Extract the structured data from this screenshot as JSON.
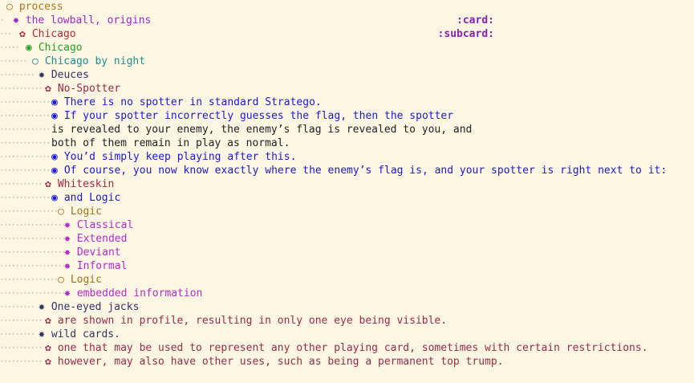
{
  "colors": {
    "background": "#fdf6e3",
    "orange": "#b5741d",
    "purple": "#9b2ac4",
    "red": "#b02a3a",
    "green": "#2a9d2a",
    "teal": "#1e8f8f",
    "navy": "#333366",
    "blue": "#1a1ad6",
    "maroon": "#9a2a4a",
    "magenta": "#b52ac8"
  },
  "lines": [
    {
      "indent": 0,
      "bullet": "○",
      "text": "process",
      "color": "orange"
    },
    {
      "indent": 1,
      "bullet": "✸",
      "text": "the lowball, origins",
      "color": "purple",
      "tag": ":card:"
    },
    {
      "indent": 2,
      "bullet": "✿",
      "text": "Chicago",
      "color": "red",
      "tag": ":subcard:"
    },
    {
      "indent": 3,
      "bullet": "◉",
      "text": "Chicago",
      "color": "green"
    },
    {
      "indent": 4,
      "bullet": "○",
      "text": "Chicago by night",
      "color": "teal"
    },
    {
      "indent": 5,
      "bullet": "✸",
      "text": "Deuces",
      "color": "navy"
    },
    {
      "indent": 6,
      "bullet": "✿",
      "text": "No-Spotter",
      "color": "maroon"
    },
    {
      "indent": 7,
      "bullet": "◉",
      "text": "There is no spotter in standard Stratego.",
      "color": "blue"
    },
    {
      "indent": 7,
      "bullet": "◉",
      "text": "If your spotter incorrectly guesses the flag, then the spotter",
      "color": "blue"
    },
    {
      "indent": 7,
      "bullet": "",
      "text": "is revealed to your enemy, the enemy’s flag is revealed to you, and",
      "color": "dark"
    },
    {
      "indent": 7,
      "bullet": "",
      "text": "both of them remain in play as normal.",
      "color": "dark"
    },
    {
      "indent": 7,
      "bullet": "◉",
      "text": "You’d simply keep playing after this.",
      "color": "blue"
    },
    {
      "indent": 7,
      "bullet": "◉",
      "text": "Of course, you now know exactly where the enemy’s flag is, and your spotter is right next to it:",
      "color": "blue"
    },
    {
      "indent": 6,
      "bullet": "✿",
      "text": "Whiteskin",
      "color": "maroon"
    },
    {
      "indent": 7,
      "bullet": "◉",
      "text": "and Logic",
      "color": "blue"
    },
    {
      "indent": 8,
      "bullet": "○",
      "text": "Logic",
      "color": "brown"
    },
    {
      "indent": 9,
      "bullet": "✸",
      "text": "Classical",
      "color": "magenta"
    },
    {
      "indent": 9,
      "bullet": "✸",
      "text": "Extended",
      "color": "magenta"
    },
    {
      "indent": 9,
      "bullet": "✸",
      "text": "Deviant",
      "color": "magenta"
    },
    {
      "indent": 9,
      "bullet": "✸",
      "text": "Informal",
      "color": "magenta"
    },
    {
      "indent": 8,
      "bullet": "○",
      "text": "Logic",
      "color": "brown"
    },
    {
      "indent": 9,
      "bullet": "✸",
      "text": "embedded information",
      "color": "magenta"
    },
    {
      "indent": 5,
      "bullet": "✸",
      "text": "One-eyed jacks",
      "color": "navy"
    },
    {
      "indent": 6,
      "bullet": "✿",
      "text": "are shown in profile, resulting in only one eye being visible.",
      "color": "maroon"
    },
    {
      "indent": 5,
      "bullet": "✸",
      "text": "wild cards.",
      "color": "navy"
    },
    {
      "indent": 6,
      "bullet": "✿",
      "text": "one that may be used to represent any other playing card, sometimes with certain restrictions.",
      "color": "maroon"
    },
    {
      "indent": 6,
      "bullet": "✿",
      "text": "however, may also have other uses, such as being a permanent top trump.",
      "color": "maroon"
    }
  ]
}
